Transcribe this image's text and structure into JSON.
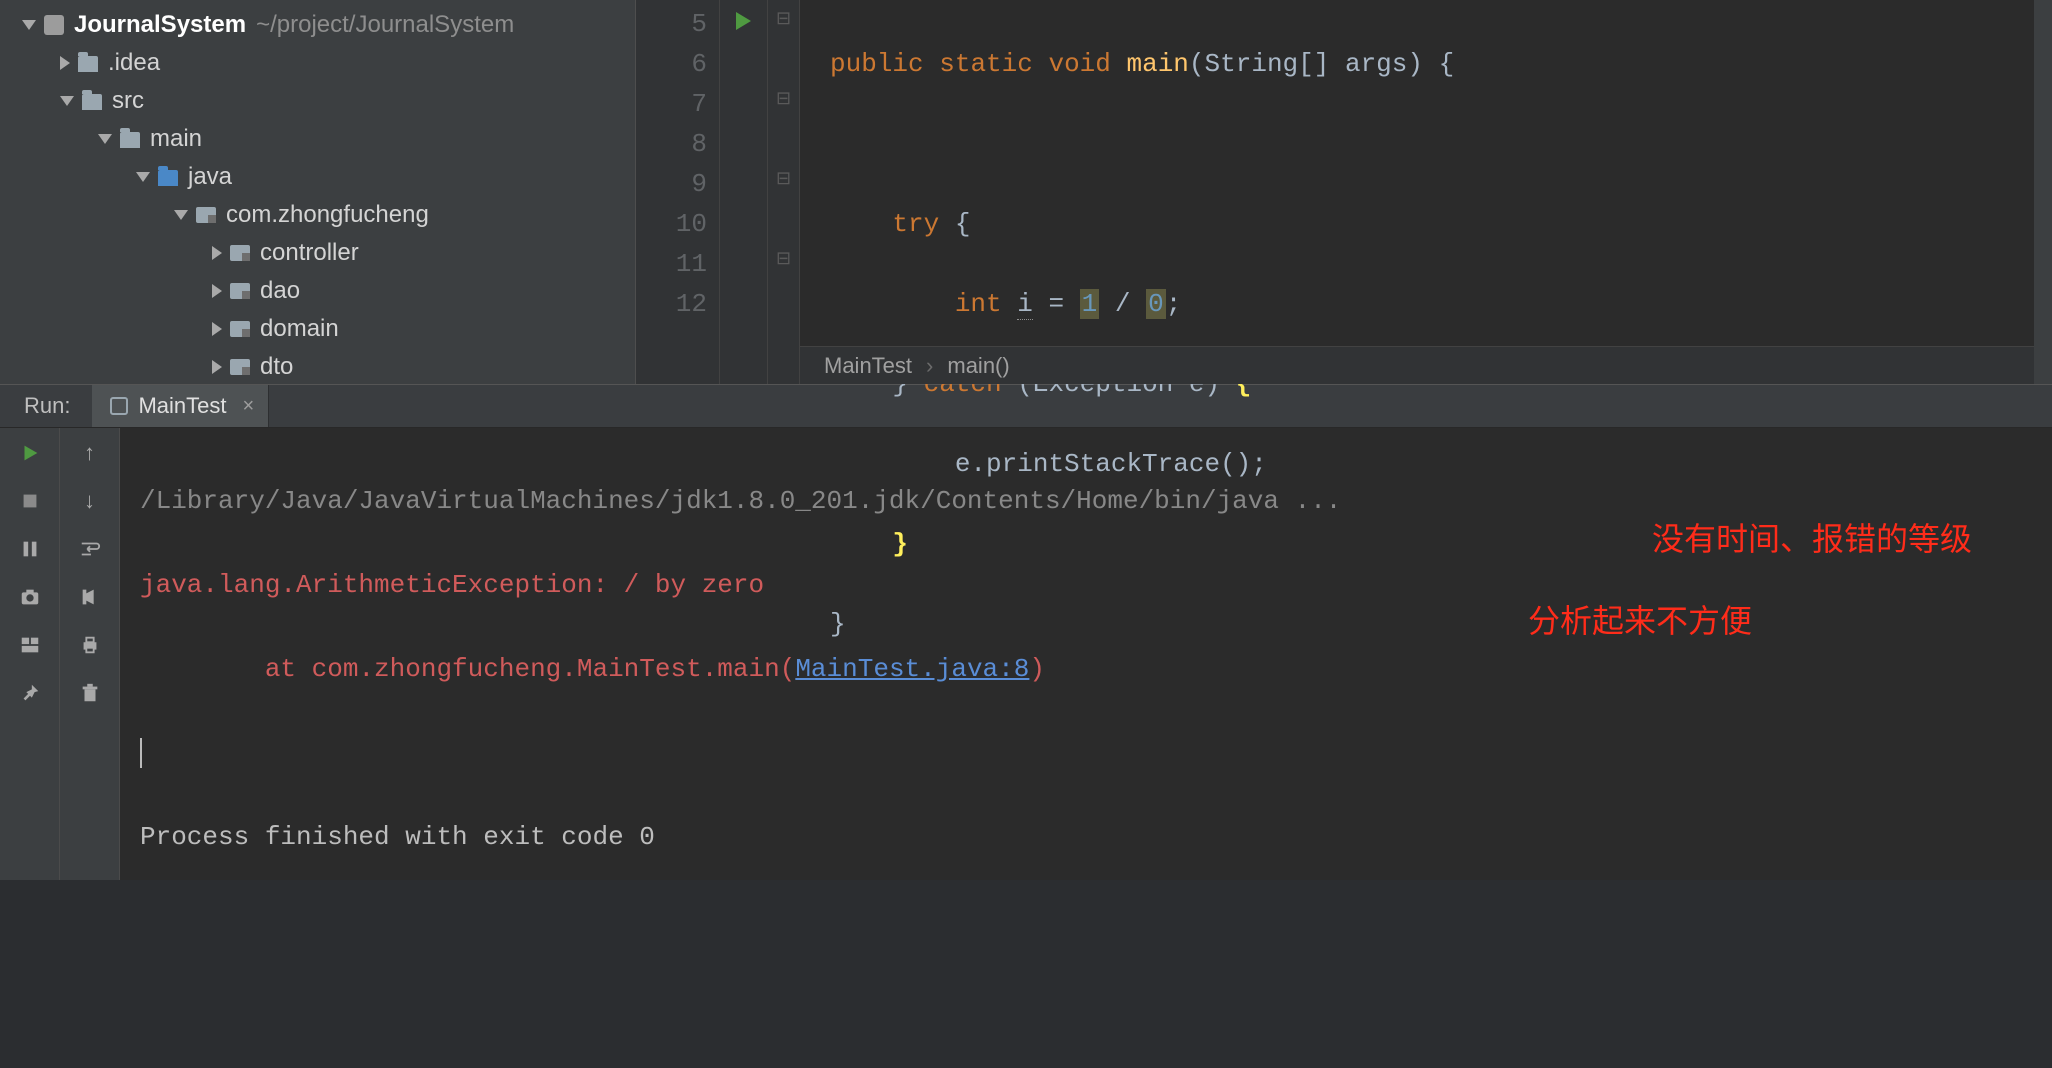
{
  "project": {
    "name": "JournalSystem",
    "path": "~/project/JournalSystem"
  },
  "tree": {
    "idea": ".idea",
    "src": "src",
    "main": "main",
    "java": "java",
    "pkg": "com.zhongfucheng",
    "controller": "controller",
    "dao": "dao",
    "domain": "domain",
    "dto": "dto"
  },
  "gutter": {
    "l5": "5",
    "l6": "6",
    "l7": "7",
    "l8": "8",
    "l9": "9",
    "l10": "10",
    "l11": "11",
    "l12": "12"
  },
  "code": {
    "kw_public": "public",
    "kw_static": "static",
    "kw_void": "void",
    "fn_main": "main",
    "type_string": "String",
    "args": "[] args",
    "kw_try": "try",
    "kw_int": "int",
    "var_i": "i",
    "eq": " = ",
    "one": "1",
    "slash": " / ",
    "zero": "0",
    "semi": ";",
    "kw_catch": "catch",
    "type_exc": "Exception",
    "var_e": "e",
    "stmt_print": "e.printStackTrace();"
  },
  "breadcrumb": {
    "class": "MainTest",
    "method": "main()"
  },
  "run": {
    "label": "Run:",
    "tab": "MainTest"
  },
  "console": {
    "cmd": "/Library/Java/JavaVirtualMachines/jdk1.8.0_201.jdk/Contents/Home/bin/java ...",
    "err1": "java.lang.ArithmeticException: / by zero",
    "err2a": "\tat com.zhongfucheng.MainTest.main(",
    "link": "MainTest.java:8",
    "err2b": ")",
    "done": "Process finished with exit code 0"
  },
  "annot": {
    "a1": "没有时间、报错的等级",
    "a2": "分析起来不方便"
  }
}
